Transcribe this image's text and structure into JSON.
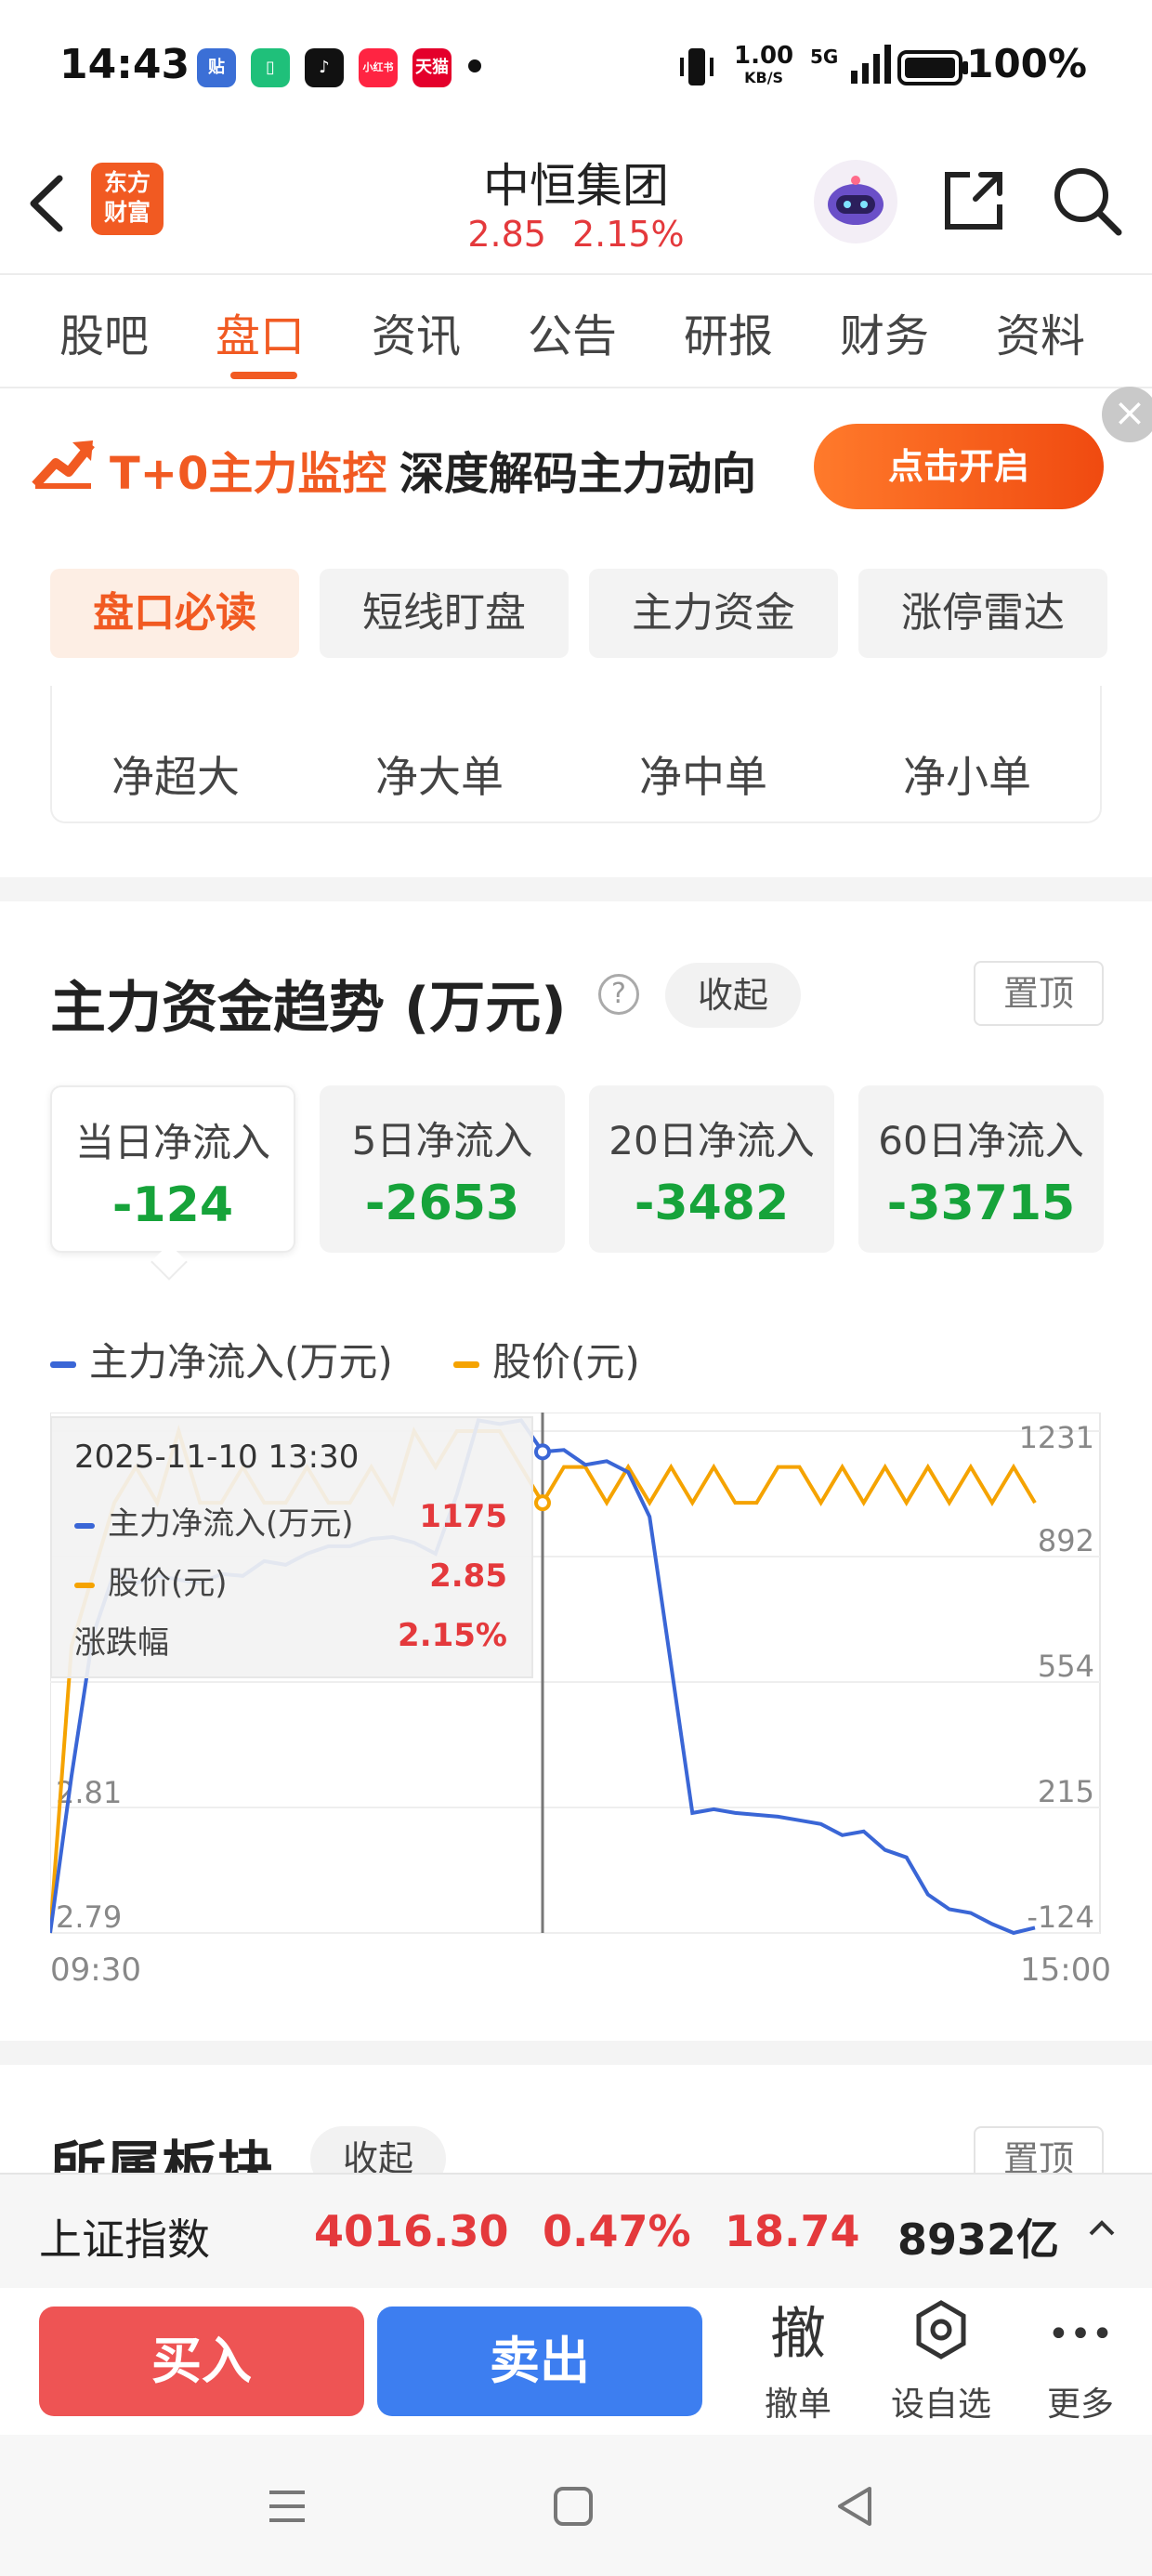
{
  "status_bar": {
    "time": "14:43",
    "app_icons": [
      {
        "name": "tieba-app-icon",
        "text": "贴",
        "color": "#3b6fd6"
      },
      {
        "name": "battery-app-icon",
        "text": "▯",
        "color": "#1fc07a"
      },
      {
        "name": "tiktok-app-icon",
        "text": "♪",
        "color": "#111111"
      },
      {
        "name": "xiaohongshu-app-icon",
        "text": "小红书",
        "color": "#ff2442"
      },
      {
        "name": "tmall-app-icon",
        "text": "天猫",
        "color": "#e4002b"
      }
    ],
    "speed_value": "1.00",
    "speed_unit": "KB/S",
    "network": "5G",
    "battery": "100%"
  },
  "header": {
    "logo_line1": "东方",
    "logo_line2": "财富",
    "stock_name": "中恒集团",
    "price": "2.85",
    "change_pct": "2.15%"
  },
  "tabs": [
    "股吧",
    "盘口",
    "资讯",
    "公告",
    "研报",
    "财务",
    "资料"
  ],
  "active_tab": "盘口",
  "banner": {
    "highlight": "T+0主力监控",
    "text": "深度解码主力动向",
    "button": "点击开启",
    "close": "×"
  },
  "subtabs": [
    "盘口必读",
    "短线盯盘",
    "主力资金",
    "涨停雷达"
  ],
  "net_items": [
    "净超大",
    "净大单",
    "净中单",
    "净小单"
  ],
  "trend_section": {
    "title": "主力资金趋势 (万元)",
    "help": "?",
    "collapse": "收起",
    "pin": "置顶"
  },
  "flow_boxes": [
    {
      "label": "当日净流入",
      "value": "-124"
    },
    {
      "label": "5日净流入",
      "value": "-2653"
    },
    {
      "label": "20日净流入",
      "value": "-3482"
    },
    {
      "label": "60日净流入",
      "value": "-33715"
    }
  ],
  "legend": {
    "series1": "主力净流入(万元)",
    "series2": "股价(元)"
  },
  "tooltip": {
    "date": "2025-11-10 13:30",
    "rows": [
      {
        "label": "主力净流入(万元)",
        "value": "1175"
      },
      {
        "label": "股价(元)",
        "value": "2.85"
      },
      {
        "label": "涨跌幅",
        "value": "2.15%"
      }
    ]
  },
  "chart_data": {
    "type": "line",
    "x_start": "09:30",
    "x_end": "15:00",
    "right_axis_ticks": [
      "1231",
      "892",
      "554",
      "215",
      "-124"
    ],
    "left_axis_ticks": [
      "2.81",
      "2.79"
    ],
    "right_ylim": [
      -124,
      1231
    ],
    "left_ylim": [
      2.79,
      2.86
    ],
    "series": [
      {
        "name": "主力净流入(万元)",
        "color": "#3a66d6",
        "values": [
          -124,
          300,
          680,
          850,
          820,
          840,
          830,
          820,
          845,
          840,
          880,
          870,
          900,
          920,
          920,
          940,
          945,
          930,
          900,
          1060,
          1260,
          1250,
          1260,
          1175,
          1180,
          1140,
          1150,
          1120,
          1000,
          600,
          200,
          210,
          200,
          195,
          190,
          180,
          170,
          140,
          150,
          100,
          80,
          -20,
          -60,
          -70,
          -100,
          -130,
          -110
        ]
      },
      {
        "name": "股价(元)",
        "color": "#f5a300",
        "values": [
          2.79,
          2.83,
          2.84,
          2.85,
          2.855,
          2.85,
          2.86,
          2.85,
          2.85,
          2.855,
          2.85,
          2.85,
          2.855,
          2.85,
          2.85,
          2.855,
          2.85,
          2.86,
          2.855,
          2.86,
          2.86,
          2.86,
          2.855,
          2.85,
          2.855,
          2.855,
          2.85,
          2.855,
          2.85,
          2.855,
          2.85,
          2.855,
          2.85,
          2.85,
          2.855,
          2.855,
          2.85,
          2.855,
          2.85,
          2.855,
          2.85,
          2.855,
          2.85,
          2.855,
          2.85,
          2.855,
          2.85
        ]
      }
    ],
    "cursor_time": "2025-11-10 13:30"
  },
  "next_section": {
    "title": "所属板块",
    "collapse": "收起",
    "pin": "置顶"
  },
  "index_bar": {
    "name": "上证指数",
    "value": "4016.30",
    "pct": "0.47%",
    "change": "18.74",
    "volume": "8932亿",
    "expand": "^"
  },
  "toolbar": {
    "buy": "买入",
    "sell": "卖出",
    "cancel_icon": "撤",
    "cancel": "撤单",
    "watch": "设自选",
    "more_icon": "•••",
    "more": "更多"
  }
}
